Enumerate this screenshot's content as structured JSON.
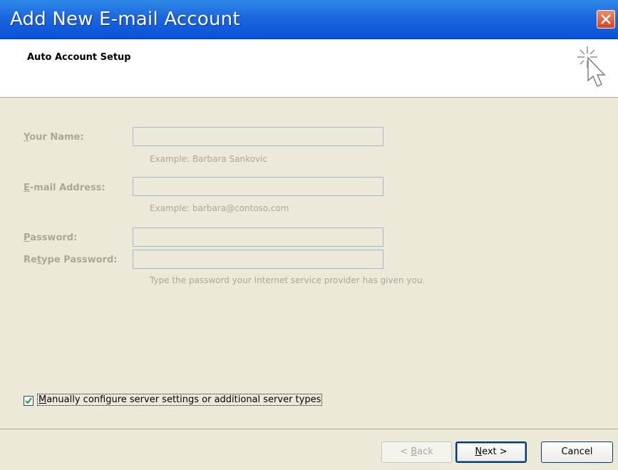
{
  "window": {
    "title": "Add New E-mail Account"
  },
  "header": {
    "heading": "Auto Account Setup"
  },
  "form": {
    "your_name": {
      "label_mnemonic": "Y",
      "label_rest": "our Name:",
      "value": "",
      "hint": "Example: Barbara Sankovic"
    },
    "email": {
      "label_mnemonic": "E",
      "label_rest": "-mail Address:",
      "value": "",
      "hint": "Example: barbara@contoso.com"
    },
    "password": {
      "label_mnemonic": "P",
      "label_rest": "assword:",
      "value": ""
    },
    "retype_password": {
      "label_pre": "Re",
      "label_mnemonic": "t",
      "label_rest": "ype Password:",
      "value": "",
      "hint": "Type the password your Internet service provider has given you."
    }
  },
  "manual_config": {
    "checked": true,
    "label_mnemonic": "M",
    "label_rest": "anually configure server settings or additional server types"
  },
  "buttons": {
    "back": {
      "pre": "< ",
      "mnemonic": "B",
      "rest": "ack",
      "enabled": false
    },
    "next": {
      "mnemonic": "N",
      "rest": "ext >"
    },
    "cancel": {
      "label": "Cancel"
    }
  },
  "colors": {
    "titlebar": "#0852d6",
    "dialog_bg": "#ece9d8",
    "disabled_text": "#aca899",
    "close_button": "#d9431d"
  }
}
